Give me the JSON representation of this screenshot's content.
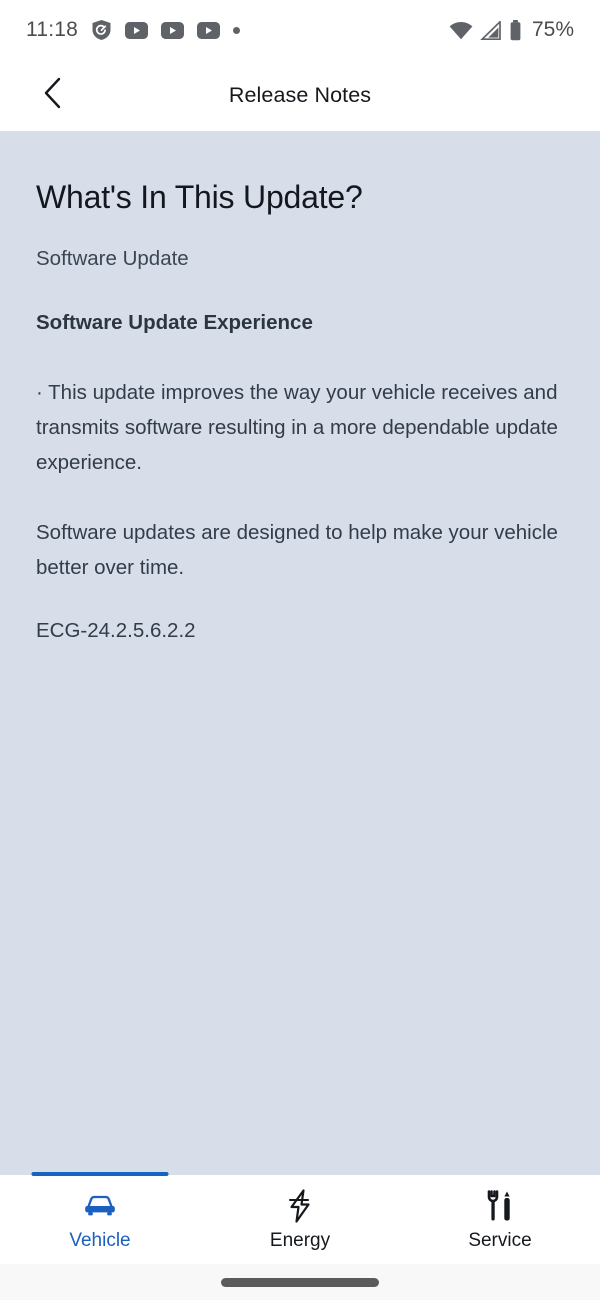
{
  "status_bar": {
    "time": "11:18",
    "battery_percent": "75%",
    "icons": [
      "shield-check-icon",
      "youtube-play-icon",
      "youtube-play-icon",
      "youtube-play-icon",
      "notification-dot-icon",
      "wifi-icon",
      "cellular-signal-icon",
      "battery-icon"
    ]
  },
  "header": {
    "back_icon": "chevron-left-icon",
    "title": "Release Notes"
  },
  "content": {
    "heading": "What's In This Update?",
    "subtitle": "Software Update",
    "section_title": "Software Update Experience",
    "paragraph_1": "· This update improves the way your vehicle receives and transmits software resulting in a more dependable update experience.",
    "paragraph_2": "Software updates are designed to help make your vehicle better over time.",
    "version": "ECG-24.2.5.6.2.2"
  },
  "bottom_nav": {
    "items": [
      {
        "label": "Vehicle",
        "icon": "car-icon",
        "active": true
      },
      {
        "label": "Energy",
        "icon": "lightning-bolt-icon",
        "active": false
      },
      {
        "label": "Service",
        "icon": "wrench-screwdriver-icon",
        "active": false
      }
    ]
  },
  "colors": {
    "content_background": "#D7DEEA",
    "accent_blue": "#1B5FC1",
    "indicator_blue": "#1565C0",
    "header_background": "#FFFFFF",
    "body_text": "#323C4A",
    "heading_text": "#14171D"
  }
}
